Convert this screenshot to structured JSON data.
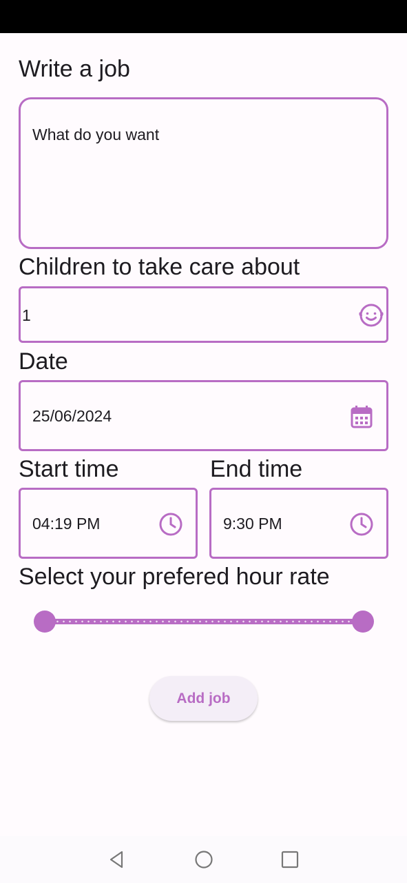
{
  "form": {
    "job_label": "Write a job",
    "job_placeholder": "What do you want",
    "children_label": "Children to take care about",
    "children_value": "1",
    "date_label": "Date",
    "date_value": "25/06/2024",
    "start_label": "Start time",
    "start_value": "04:19 PM",
    "end_label": "End time",
    "end_value": "9:30 PM",
    "rate_label": "Select your prefered hour rate",
    "rate_range": {
      "min_fraction": 0.0,
      "max_fraction": 1.0
    },
    "add_button_label": "Add job"
  },
  "icons": {
    "children": "baby-face-icon",
    "date": "calendar-icon",
    "start": "clock-icon",
    "end": "clock-icon",
    "nav_back": "back-triangle-icon",
    "nav_home": "home-circle-icon",
    "nav_recents": "recents-square-icon"
  },
  "colors": {
    "accent": "#b86cc4",
    "background": "#fffbfe",
    "text": "#1d1b20"
  }
}
